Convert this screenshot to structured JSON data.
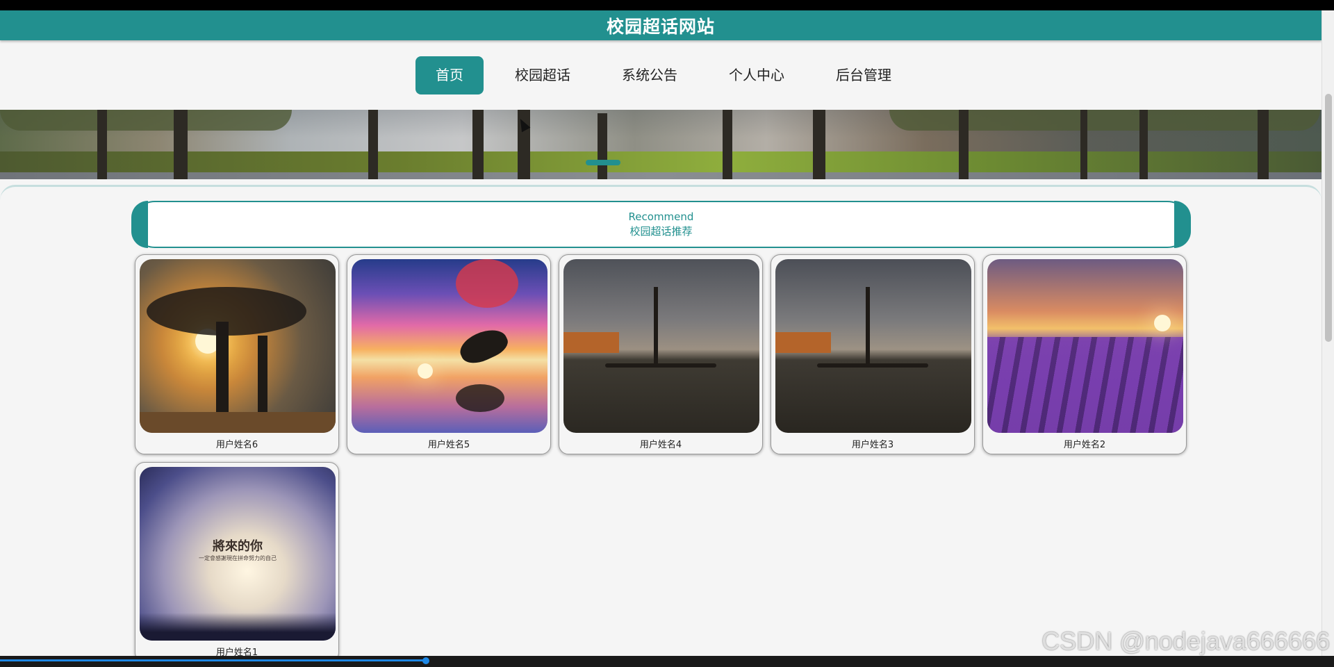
{
  "header": {
    "title": "校园超话网站"
  },
  "nav": {
    "items": [
      {
        "label": "首页",
        "active": true
      },
      {
        "label": "校园超话",
        "active": false
      },
      {
        "label": "系统公告",
        "active": false
      },
      {
        "label": "个人中心",
        "active": false
      },
      {
        "label": "后台管理",
        "active": false
      }
    ]
  },
  "recommend": {
    "title_en": "Recommend",
    "title_cn": "校园超话推荐"
  },
  "cards": [
    {
      "name": "用户姓名6",
      "image": "sunset-tree"
    },
    {
      "name": "用户姓名5",
      "image": "dolphin-sunset"
    },
    {
      "name": "用户姓名4",
      "image": "lake-tree"
    },
    {
      "name": "用户姓名3",
      "image": "lake-tree"
    },
    {
      "name": "用户姓名2",
      "image": "lavender-field"
    },
    {
      "name": "用户姓名1",
      "image": "sky-quote"
    }
  ],
  "image_texts": {
    "sky_quote_line1": "將來的你",
    "sky_quote_line2": "一定會感謝現在拼命努力的自己"
  },
  "watermark": "CSDN @nodejava666666",
  "colors": {
    "accent": "#22908f",
    "background": "#f5f5f5",
    "text": "#222222"
  }
}
